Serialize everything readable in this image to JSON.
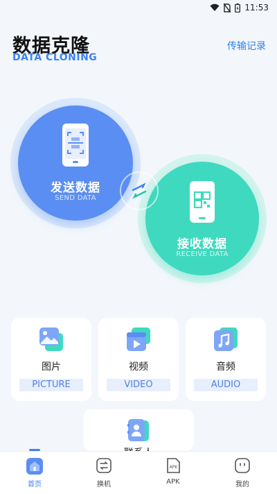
{
  "status": {
    "time": "11:53"
  },
  "header": {
    "title": "数据克隆",
    "subtitle": "DATA CLONING",
    "history_link": "传输记录"
  },
  "send": {
    "title": "发送数据",
    "subtitle": "SEND DATA"
  },
  "receive": {
    "title": "接收数据",
    "subtitle": "RECEIVE DATA"
  },
  "categories": [
    {
      "label": "图片",
      "tag": "PICTURE",
      "icon": "picture-icon"
    },
    {
      "label": "视频",
      "tag": "VIDEO",
      "icon": "video-icon"
    },
    {
      "label": "音频",
      "tag": "AUDIO",
      "icon": "audio-icon"
    },
    {
      "label": "联系人",
      "tag": "",
      "icon": "contacts-icon"
    }
  ],
  "nav": [
    {
      "label": "首页",
      "icon": "home-icon",
      "active": true
    },
    {
      "label": "换机",
      "icon": "switch-icon"
    },
    {
      "label": "APK",
      "icon": "apk-icon",
      "icon_text": "APK"
    },
    {
      "label": "我的",
      "icon": "profile-icon"
    }
  ],
  "colors": {
    "accent": "#3b82f6",
    "send": "#5b8ef2",
    "receive": "#3fd9bf",
    "background": "#f3f7fb"
  }
}
